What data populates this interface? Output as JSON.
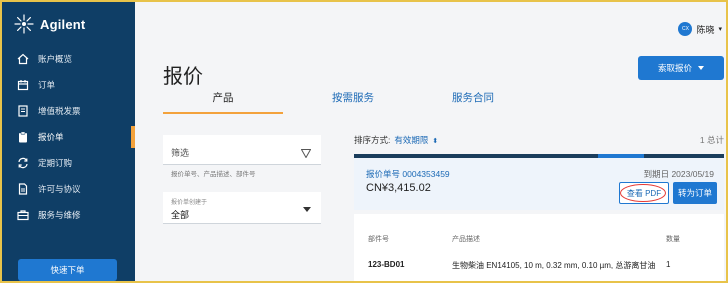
{
  "brand": {
    "logo_text": "Agilent"
  },
  "sidebar": {
    "items": [
      {
        "label": "账户概览",
        "icon": "home-icon"
      },
      {
        "label": "订单",
        "icon": "calendar-icon"
      },
      {
        "label": "增值税发票",
        "icon": "invoice-icon"
      },
      {
        "label": "报价单",
        "icon": "clipboard-icon",
        "active": true
      },
      {
        "label": "定期订购",
        "icon": "repeat-icon"
      },
      {
        "label": "许可与协议",
        "icon": "document-icon"
      },
      {
        "label": "服务与维修",
        "icon": "briefcase-icon"
      }
    ],
    "cta_label": "快速下单"
  },
  "header": {
    "user_initials": "CX",
    "user_name": "陈晓",
    "caret": "▾"
  },
  "page": {
    "title": "报价",
    "quote_button_label": "索取报价"
  },
  "tabs": [
    {
      "label": "产品",
      "active": true
    },
    {
      "label": "按需服务"
    },
    {
      "label": "服务合同"
    }
  ],
  "filter": {
    "label": "筛选",
    "hint": "报价单号、产品描述、部件号",
    "select_label": "报价单创建于",
    "select_value": "全部"
  },
  "results": {
    "sort_label": "排序方式:",
    "sort_value": "有效期限",
    "sort_icon": "⬍",
    "total": "1 总计"
  },
  "quote": {
    "number_label": "报价单号",
    "number": "0004353459",
    "amount": "CN¥3,415.02",
    "expiry": "到期日 2023/05/19",
    "pdf_label": "查看 PDF",
    "order_label": "转为订单"
  },
  "line_items": {
    "headers": [
      "部件号",
      "产品描述",
      "数量"
    ],
    "rows": [
      {
        "part": "123-BD01",
        "desc": "生物柴油 EN14105, 10 m, 0.32 mm, 0.10 µm, 总游离甘油",
        "qty": "1"
      }
    ]
  },
  "colors": {
    "sidebar": "#0f3e66",
    "accent": "#f3a23c",
    "primary": "#1f78d1",
    "highlight_ring": "#e53935"
  }
}
